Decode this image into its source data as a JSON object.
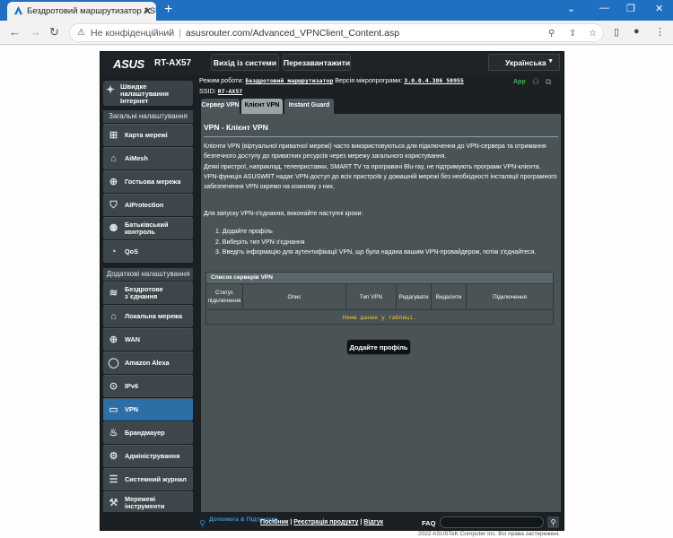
{
  "browser": {
    "tab_title": "Бездротовий маршрутизатор ASUS",
    "address_insecure": "Не конфіденційний",
    "address_url": "asusrouter.com/Advanced_VPNClient_Content.asp"
  },
  "router": {
    "brand": "ASUS",
    "model": "RT-AX57",
    "logout": "Вихід із системи",
    "reboot": "Перезавантажити",
    "language": "Українська",
    "mode_label": "Режим роботи:",
    "mode_value": "Бездротовий маршрутизатор",
    "fw_label": "Версія мікропрограми:",
    "fw_value": "3.0.0.4.386_50955",
    "ssid_label": "SSID:",
    "ssid_value": "RT-AX57",
    "app": "App"
  },
  "sidebar": {
    "quick": "Швидке налаштування Інтернет",
    "general_header": "Загальні налаштування",
    "general": [
      "Карта мережі",
      "AiMesh",
      "Гостьова мережа",
      "AiProtection",
      "Батьківський контроль",
      "QoS"
    ],
    "advanced_header": "Додаткові налаштування",
    "advanced": [
      "Бездротове з`єднання",
      "Локальна мережа",
      "WAN",
      "Amazon Alexa",
      "IPv6",
      "VPN",
      "Брандмауер",
      "Адміністрування",
      "Системний журнал",
      "Мережеві інструменти"
    ]
  },
  "tabs": [
    "Сервер VPN",
    "Клієнт VPN",
    "Instant Guard"
  ],
  "content": {
    "title": "VPN - Клієнт VPN",
    "desc_lines": [
      "Клієнти VPN (віртуальної приватної мережі) часто використовуються для підключення до VPN-сервера та отримання",
      "безпечного доступу до приватних ресурсів через мережу загального користування.",
      "Деякі пристрої, наприклад, телеприставки, SMART TV та програвачі Blu-ray, не підтримують програми VPN-клієнта.",
      "VPN-функція ASUSWRT надає VPN-доступ до всіх пристроїв у домашній мережі без необхідності інсталяції програмного",
      "забезпечення VPN окремо на кожному з них."
    ],
    "steps_intro": "Для запуску VPN-з'єднання, виконайте наступні кроки:",
    "steps": [
      "1. Додайте профіль",
      "2. Виберіть тип VPN-з'єднання",
      "3. Введіть інформацію для аутентифікації VPN, що була надана вашим VPN-провайдером, потім з'єднайтеся."
    ],
    "table_title": "Список серверів VPN",
    "columns": [
      "Статус підключення",
      "Опис",
      "Тип VPN",
      "Редагувати",
      "Видалити",
      "Підключення"
    ],
    "empty": "Нема даних у таблиці.",
    "add_button": "Додайте профіль"
  },
  "footer": {
    "help": "Допомога & Підтримка",
    "links": [
      "Посібник",
      "Реєстрація продукту",
      "Відгук"
    ],
    "faq": "FAQ",
    "copyright": "2022 ASUSTeK Computer Inc. Всі права застережені."
  }
}
